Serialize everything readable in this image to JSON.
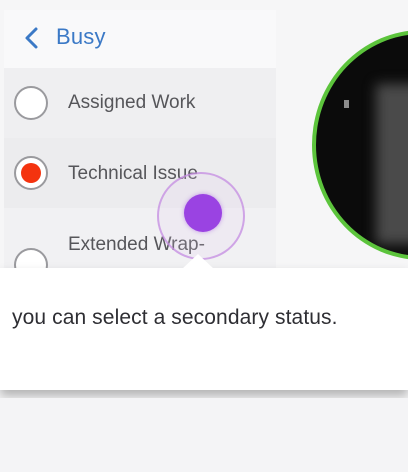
{
  "menu": {
    "title": "Busy",
    "options": [
      {
        "label": "Assigned Work",
        "selected": false
      },
      {
        "label": "Technical Issue",
        "selected": true
      },
      {
        "label": "Extended Wrap-",
        "selected": false
      }
    ]
  },
  "tooltip": {
    "text": "you can select a secondary status."
  },
  "colors": {
    "accent": "#3b79c6",
    "selected_radio": "#f4330f",
    "click_indicator": "#9a43e2",
    "avatar_ring": "#5cc43c"
  },
  "icons": {
    "back": "chevron-left-icon"
  }
}
